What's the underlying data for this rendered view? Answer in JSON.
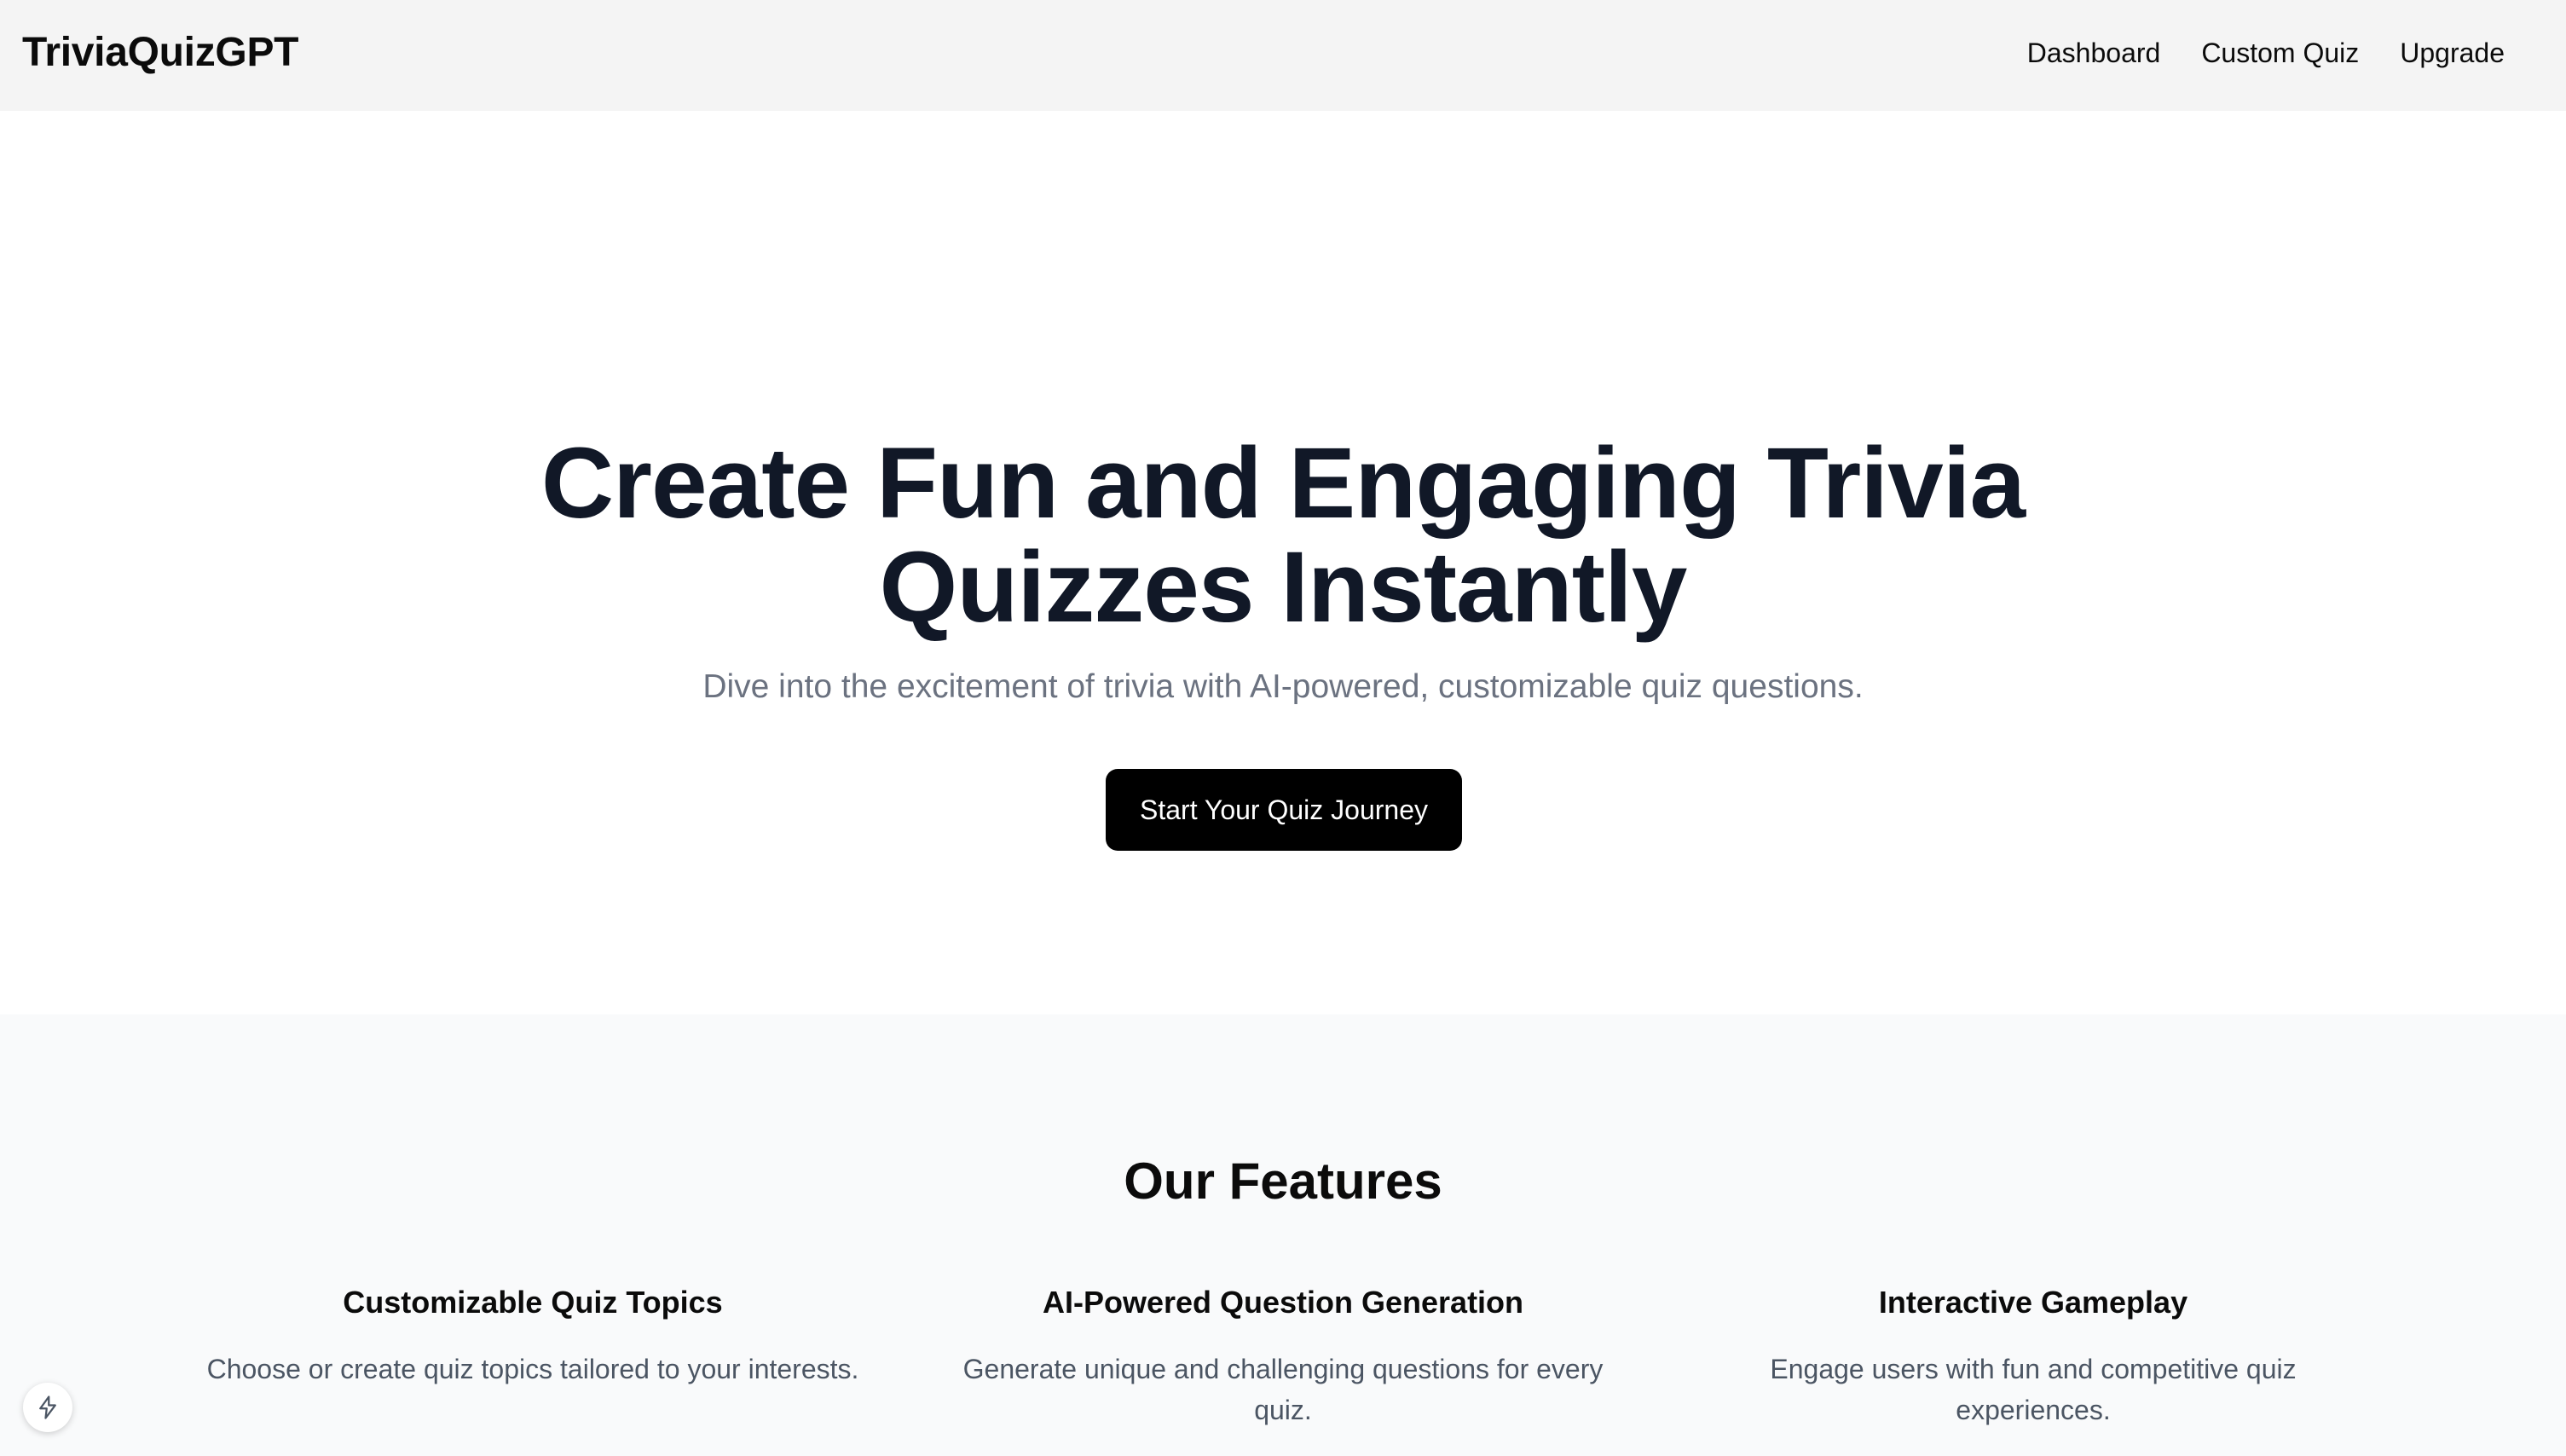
{
  "header": {
    "brand": "TriviaQuizGPT",
    "nav": [
      {
        "label": "Dashboard"
      },
      {
        "label": "Custom Quiz"
      },
      {
        "label": "Upgrade"
      }
    ]
  },
  "hero": {
    "title_line1": "Create Fun and Engaging Trivia",
    "title_line2": "Quizzes Instantly",
    "subtitle": "Dive into the excitement of trivia with AI-powered, customizable quiz questions.",
    "cta_label": "Start Your Quiz Journey"
  },
  "features": {
    "title": "Our Features",
    "items": [
      {
        "title": "Customizable Quiz Topics",
        "description": "Choose or create quiz topics tailored to your interests."
      },
      {
        "title": "AI-Powered Question Generation",
        "description": "Generate unique and challenging questions for every quiz."
      },
      {
        "title": "Interactive Gameplay",
        "description": "Engage users with fun and competitive quiz experiences."
      }
    ]
  },
  "floating_badge": {
    "icon": "lightning-bolt-icon"
  },
  "colors": {
    "header_bg": "#f4f4f4",
    "heading_text": "#111827",
    "muted_text": "#6b7280",
    "cta_bg": "#000000",
    "features_bg": "#f9fafb"
  }
}
